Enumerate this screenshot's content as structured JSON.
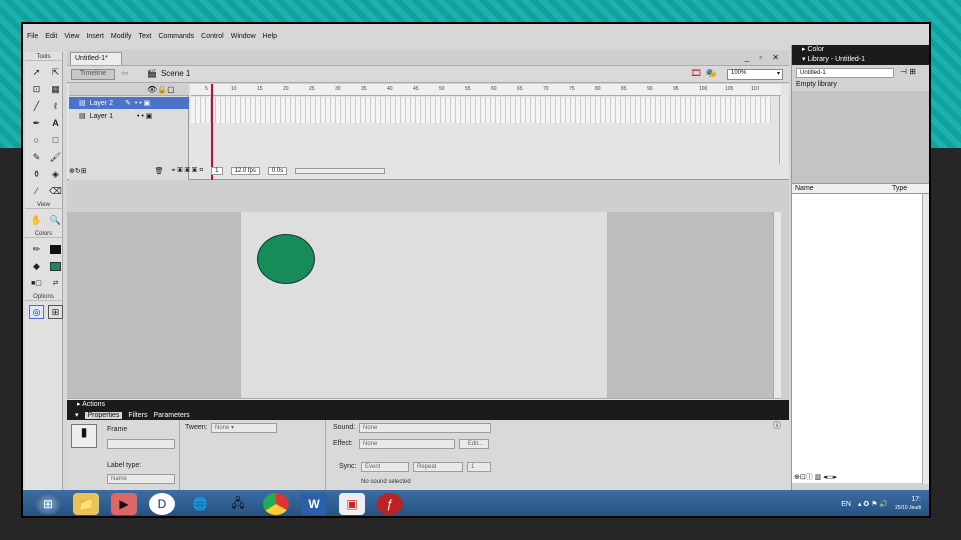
{
  "menu": [
    "File",
    "Edit",
    "View",
    "Insert",
    "Modify",
    "Text",
    "Commands",
    "Control",
    "Window",
    "Help"
  ],
  "toolbox": {
    "tools_label": "Tools",
    "view_label": "View",
    "colors_label": "Colors",
    "options_label": "Options",
    "colors": {
      "stroke": "#111111",
      "fill": "#178c5a"
    }
  },
  "document": {
    "tab_title": "Untitled-1*",
    "timeline_button": "Timeline",
    "scene_label": "Scene 1",
    "zoom": "100%"
  },
  "timeline": {
    "layers": [
      {
        "name": "Layer 2",
        "selected": true
      },
      {
        "name": "Layer 1",
        "selected": false
      }
    ],
    "ruler_ticks": [
      "5",
      "10",
      "15",
      "20",
      "25",
      "30",
      "35",
      "40",
      "45",
      "50",
      "55",
      "60",
      "65",
      "70",
      "75",
      "80",
      "85",
      "90",
      "95",
      "100",
      "105",
      "110"
    ],
    "current_frame": "1",
    "fps": "12.0 fps",
    "elapsed": "0.0s"
  },
  "stage": {
    "shape": "ellipse",
    "fill": "#178c5a"
  },
  "panels": {
    "actions": "Actions",
    "tabs": [
      "Properties",
      "Filters",
      "Parameters"
    ],
    "frame_label": "Frame",
    "tween_label": "Tween:",
    "tween_value": "None",
    "label_type_label": "Label type:",
    "label_type_value": "Name",
    "sound_label": "Sound:",
    "sound_value": "None",
    "effect_label": "Effect:",
    "effect_value": "None",
    "edit_button": "Edit...",
    "sync_label": "Sync:",
    "sync_value": "Event",
    "repeat_value": "Repeat",
    "repeat_count": "1",
    "status": "No sound selected"
  },
  "right_panel": {
    "color_title": "Color",
    "library_title": "Library - Untitled-1",
    "library_doc": "Untitled-1",
    "empty_text": "Empty library",
    "col_name": "Name",
    "col_type": "Type"
  },
  "taskbar": {
    "lang": "EN",
    "time": "17:",
    "date": "25/10 Jeudi"
  }
}
